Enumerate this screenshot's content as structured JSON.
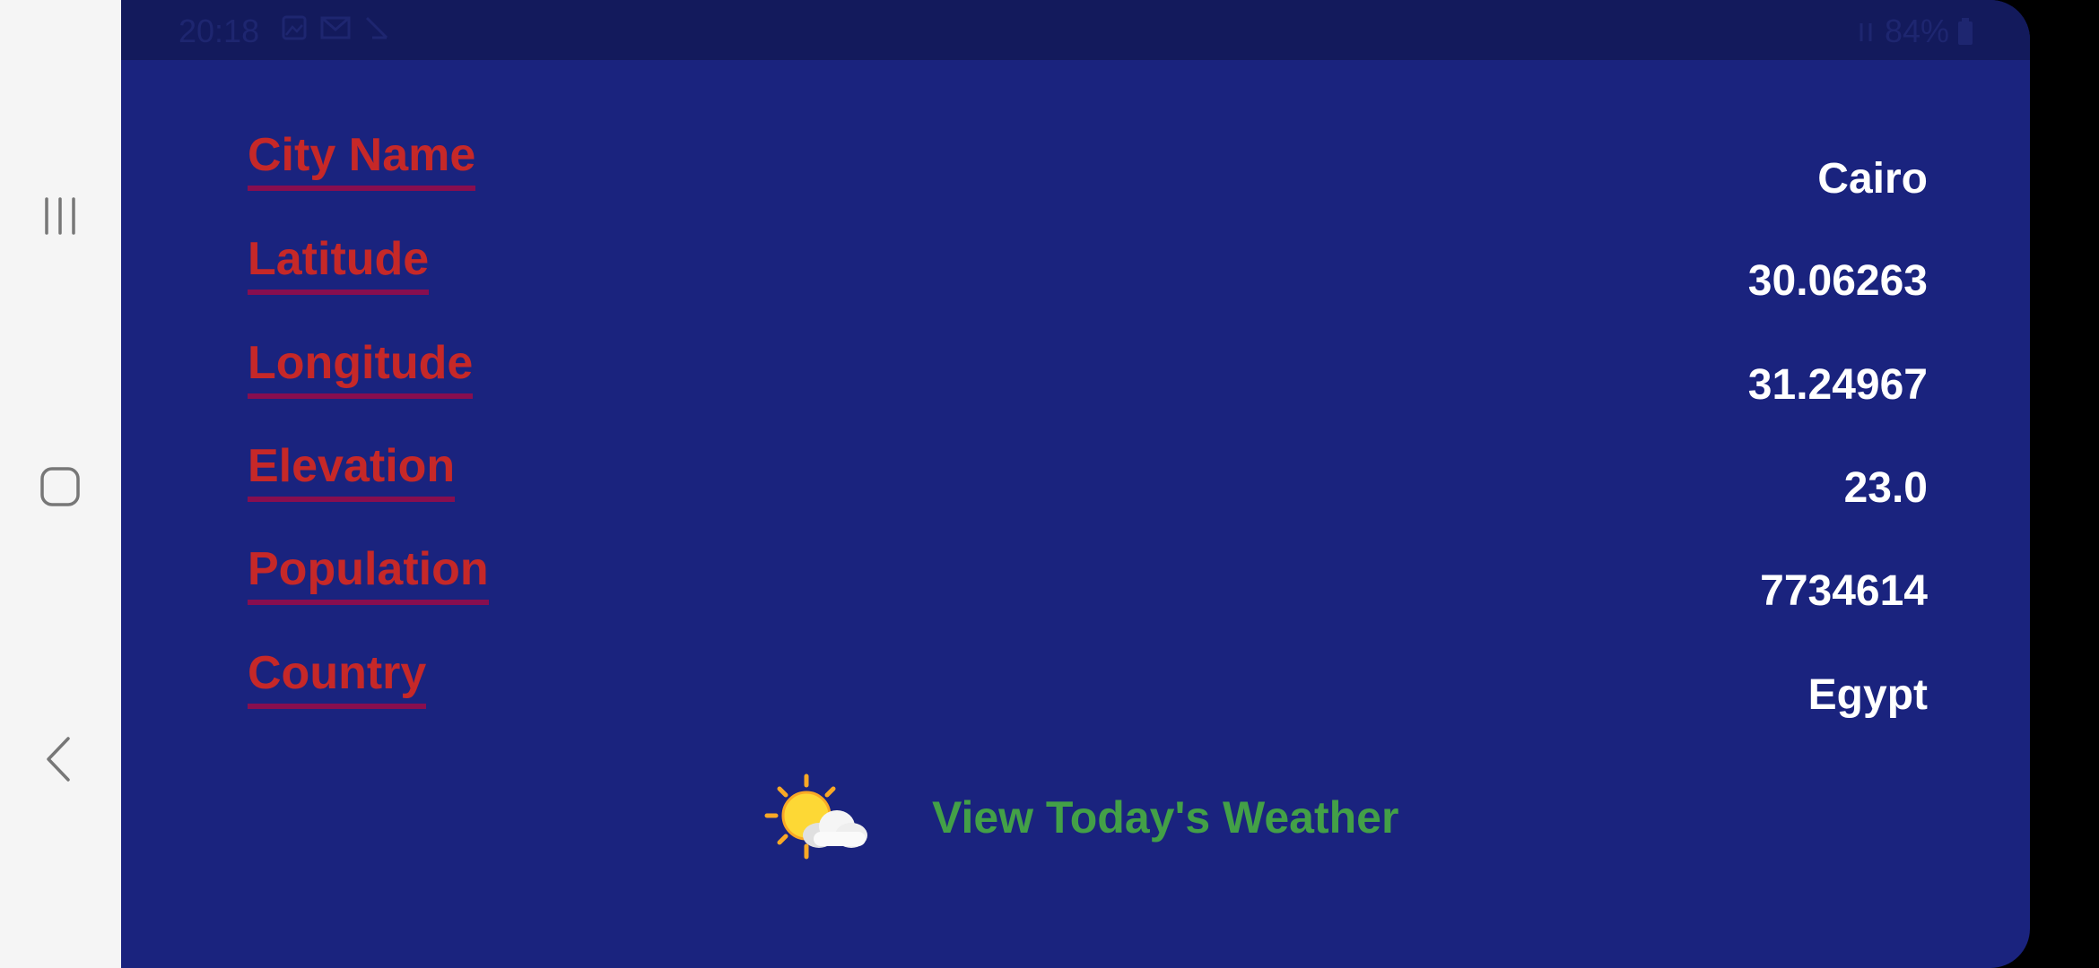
{
  "status_bar": {
    "time": "20:18",
    "battery": "84%"
  },
  "navigation": {
    "recents_icon": "recents-icon",
    "home_icon": "home-icon",
    "back_icon": "back-icon"
  },
  "city": {
    "rows": [
      {
        "label": "City Name",
        "value": "Cairo"
      },
      {
        "label": "Latitude",
        "value": "30.06263"
      },
      {
        "label": "Longitude",
        "value": "31.24967"
      },
      {
        "label": "Elevation",
        "value": "23.0"
      },
      {
        "label": "Population",
        "value": "7734614"
      },
      {
        "label": "Country",
        "value": "Egypt"
      }
    ]
  },
  "weather_button": {
    "icon": "sun-behind-cloud-icon",
    "label": "View Today's Weather"
  },
  "colors": {
    "background": "#1a237e",
    "status_bar": "#131a5c",
    "label": "#c62828",
    "label_underline": "#880e4f",
    "value": "#ffffff",
    "weather_link": "#43a047",
    "navbar": "#f5f5f5"
  }
}
